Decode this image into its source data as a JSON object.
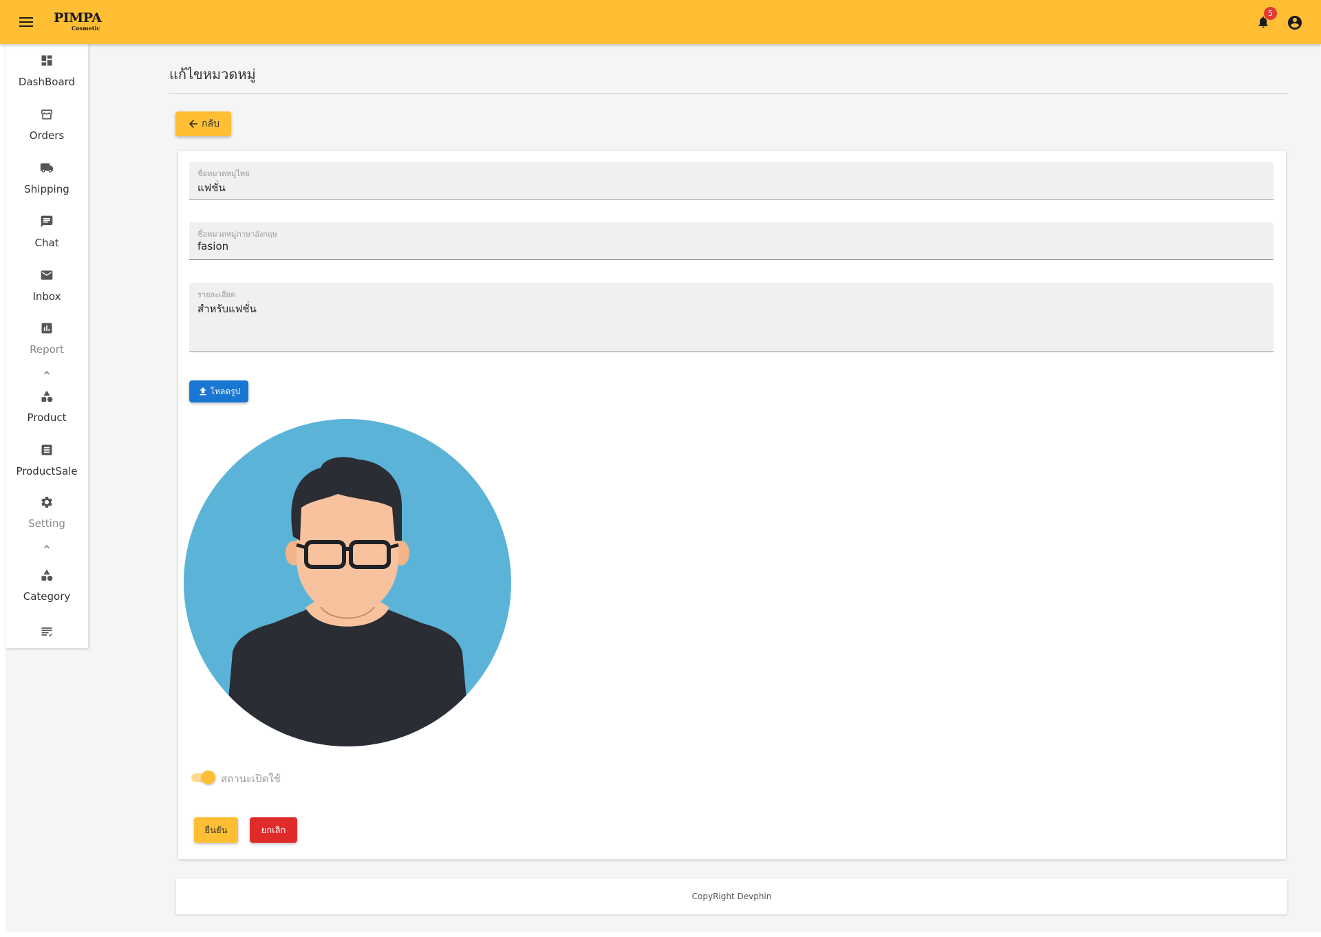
{
  "header": {
    "brand": "PIMPA",
    "brand_sub": "Cosmetic",
    "notification_count": "5",
    "accent_color": "#ffbe33"
  },
  "sidebar": {
    "items": [
      {
        "label": "DashBoard",
        "icon": "dashboard-icon"
      },
      {
        "label": "Orders",
        "icon": "store-icon"
      },
      {
        "label": "Shipping",
        "icon": "truck-icon"
      },
      {
        "label": "Chat",
        "icon": "chat-icon"
      },
      {
        "label": "Inbox",
        "icon": "mail-icon"
      },
      {
        "label": "Report",
        "icon": "bar-chart-icon"
      },
      {
        "label": "Product",
        "icon": "shapes-icon"
      },
      {
        "label": "ProductSale",
        "icon": "list-icon"
      },
      {
        "label": "Setting",
        "icon": "gear-icon"
      },
      {
        "label": "Category",
        "icon": "shapes-icon"
      },
      {
        "label": "",
        "icon": "checklist-icon"
      }
    ]
  },
  "main": {
    "title": "แก้ไขหมวดหมู่",
    "back_label": "กลับ",
    "form": {
      "name_th_label": "ชื่อหมวดหมู่ไทย",
      "name_th_value": "แฟชั่น",
      "name_en_label": "ชื่อหมวดหมู่ภาษาอังกฤษ",
      "name_en_value": "fasion",
      "detail_label": "รายละเอียด",
      "detail_value": "สำหรับแฟชั่น",
      "upload_label": "โหลดรูป",
      "status_label": "สถานะเปิดใช้",
      "status_on": true,
      "confirm_label": "ยืนยัน",
      "cancel_label": "ยกเลิก"
    }
  },
  "footer": {
    "text": "CopyRight Devphin"
  }
}
